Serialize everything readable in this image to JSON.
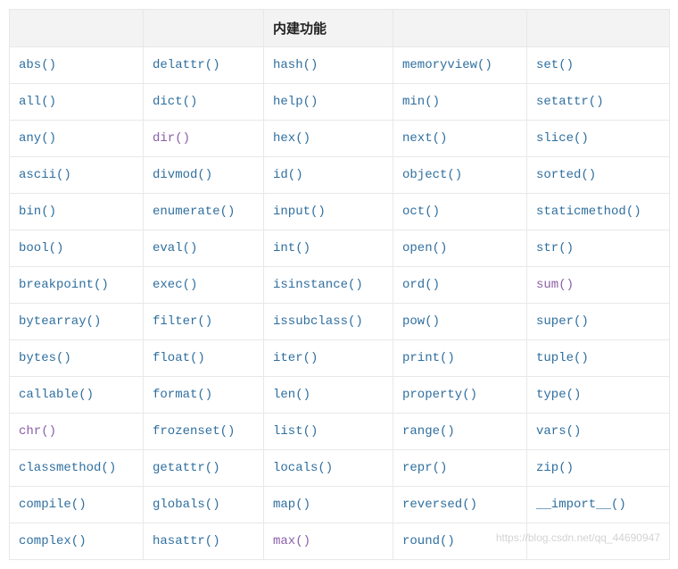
{
  "header": [
    "",
    "",
    "内建功能",
    "",
    ""
  ],
  "rows": [
    [
      {
        "t": "abs()"
      },
      {
        "t": "delattr()"
      },
      {
        "t": "hash()"
      },
      {
        "t": "memoryview()"
      },
      {
        "t": "set()"
      }
    ],
    [
      {
        "t": "all()"
      },
      {
        "t": "dict()"
      },
      {
        "t": "help()"
      },
      {
        "t": "min()"
      },
      {
        "t": "setattr()"
      }
    ],
    [
      {
        "t": "any()"
      },
      {
        "t": "dir()",
        "v": true
      },
      {
        "t": "hex()"
      },
      {
        "t": "next()"
      },
      {
        "t": "slice()"
      }
    ],
    [
      {
        "t": "ascii()"
      },
      {
        "t": "divmod()"
      },
      {
        "t": "id()"
      },
      {
        "t": "object()"
      },
      {
        "t": "sorted()"
      }
    ],
    [
      {
        "t": "bin()"
      },
      {
        "t": "enumerate()"
      },
      {
        "t": "input()"
      },
      {
        "t": "oct()"
      },
      {
        "t": "staticmethod()"
      }
    ],
    [
      {
        "t": "bool()"
      },
      {
        "t": "eval()"
      },
      {
        "t": "int()"
      },
      {
        "t": "open()"
      },
      {
        "t": "str()"
      }
    ],
    [
      {
        "t": "breakpoint()"
      },
      {
        "t": "exec()"
      },
      {
        "t": "isinstance()"
      },
      {
        "t": "ord()"
      },
      {
        "t": "sum()",
        "v": true
      }
    ],
    [
      {
        "t": "bytearray()"
      },
      {
        "t": "filter()"
      },
      {
        "t": "issubclass()"
      },
      {
        "t": "pow()"
      },
      {
        "t": "super()"
      }
    ],
    [
      {
        "t": "bytes()"
      },
      {
        "t": "float()"
      },
      {
        "t": "iter()"
      },
      {
        "t": "print()"
      },
      {
        "t": "tuple()"
      }
    ],
    [
      {
        "t": "callable()"
      },
      {
        "t": "format()"
      },
      {
        "t": "len()"
      },
      {
        "t": "property()"
      },
      {
        "t": "type()"
      }
    ],
    [
      {
        "t": "chr()",
        "v": true
      },
      {
        "t": "frozenset()"
      },
      {
        "t": "list()"
      },
      {
        "t": "range()"
      },
      {
        "t": "vars()"
      }
    ],
    [
      {
        "t": "classmethod()"
      },
      {
        "t": "getattr()"
      },
      {
        "t": "locals()"
      },
      {
        "t": "repr()"
      },
      {
        "t": "zip()"
      }
    ],
    [
      {
        "t": "compile()"
      },
      {
        "t": "globals()"
      },
      {
        "t": "map()"
      },
      {
        "t": "reversed()"
      },
      {
        "t": "__import__()"
      }
    ],
    [
      {
        "t": "complex()"
      },
      {
        "t": "hasattr()"
      },
      {
        "t": "max()",
        "v": true
      },
      {
        "t": "round()"
      },
      {
        "t": ""
      }
    ]
  ],
  "watermark": "https://blog.csdn.net/qq_44690947"
}
